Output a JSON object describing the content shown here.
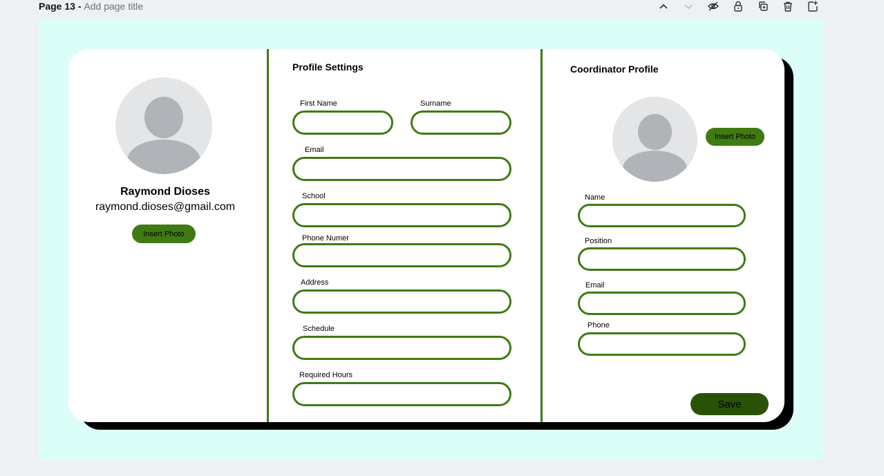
{
  "header": {
    "page_number": "Page 13",
    "separator": " - ",
    "title_placeholder": "Add page title",
    "tools": [
      "chevron-up-icon",
      "chevron-down-icon",
      "hide-icon",
      "lock-icon",
      "duplicate-icon",
      "delete-icon",
      "add-page-icon"
    ]
  },
  "profile": {
    "name": "Raymond Dioses",
    "email": "raymond.dioses@gmail.com",
    "insert_photo": "Insert Photo"
  },
  "settings": {
    "heading": "Profile Settings",
    "first_name_label": "First Name",
    "surname_label": "Surname",
    "email_label": "Email",
    "school_label": "School",
    "phone_label": "Phone Numer",
    "address_label": "Address",
    "schedule_label": "Schedule",
    "required_hours_label": "Required Hours"
  },
  "coordinator": {
    "heading": "Coordinator Profile",
    "insert_photo": "Insert Photo",
    "name_label": "Name",
    "position_label": "Position",
    "email_label": "Email",
    "phone_label": "Phone",
    "save_label": "Save"
  },
  "colors": {
    "canvas_bg": "#dcfef8",
    "accent_green": "#3f7a12",
    "save_green": "#2a5206",
    "avatar_bg": "#e4e5e7",
    "avatar_fg": "#b0b4b8"
  }
}
